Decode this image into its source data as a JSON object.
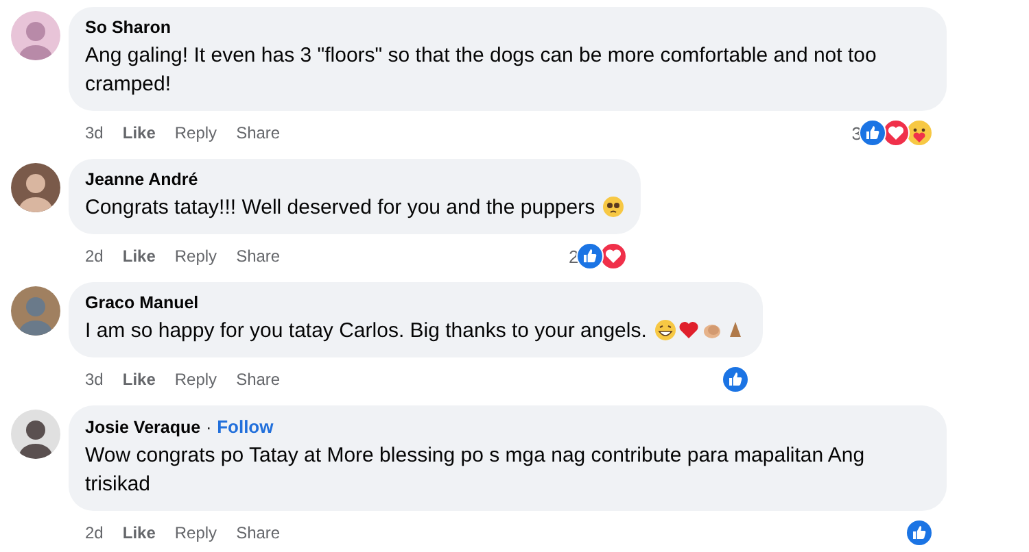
{
  "comments": [
    {
      "author": "So Sharon",
      "text": "Ang galing! It even has 3 \"floors\" so that the dogs can be more comfortable and not too cramped!",
      "time": "3d",
      "actions": [
        "Like",
        "Reply",
        "Share"
      ],
      "reaction_count": "3",
      "reactions": [
        {
          "kind": "like"
        },
        {
          "kind": "love"
        },
        {
          "kind": "care"
        }
      ]
    },
    {
      "author": "Jeanne André",
      "text": "Congrats tatay!!! Well deserved for you and the puppers",
      "emojis": [
        {
          "kind": "pleading"
        }
      ],
      "time": "2d",
      "actions": [
        "Like",
        "Reply",
        "Share"
      ],
      "reaction_count": "2",
      "reactions": [
        {
          "kind": "like"
        },
        {
          "kind": "love"
        }
      ]
    },
    {
      "author": "Graco Manuel",
      "text": "I am so happy for you tatay Carlos. Big thanks to your angels.",
      "emojis": [
        {
          "kind": "grin"
        },
        {
          "kind": "heart"
        },
        {
          "kind": "clap"
        },
        {
          "kind": "pray"
        }
      ],
      "time": "3d",
      "actions": [
        "Like",
        "Reply",
        "Share"
      ],
      "reactions": [
        {
          "kind": "like"
        }
      ]
    },
    {
      "author": "Josie Veraque",
      "separator": "·",
      "follow": "Follow",
      "text": "Wow congrats po Tatay at More blessing po s mga nag contribute para mapalitan Ang trisikad",
      "time": "2d",
      "actions": [
        "Like",
        "Reply",
        "Share"
      ],
      "reactions": [
        {
          "kind": "like"
        }
      ]
    }
  ]
}
